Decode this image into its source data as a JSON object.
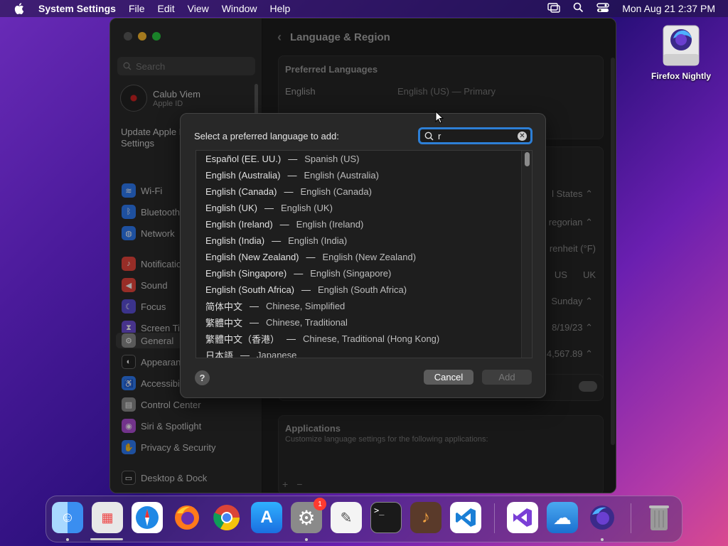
{
  "menubar": {
    "app_name": "System Settings",
    "items": [
      "File",
      "Edit",
      "View",
      "Window",
      "Help"
    ],
    "clock": "Mon Aug 21  2:37 PM"
  },
  "sidebar": {
    "search_placeholder": "Search",
    "profile": {
      "name": "Calub Viem",
      "sub": "Apple ID"
    },
    "update_text": "Update Apple ID Settings",
    "items": [
      {
        "label": "Wi-Fi",
        "color": "#2f7bf5",
        "icon": "wifi-icon"
      },
      {
        "label": "Bluetooth",
        "color": "#2f7bf5",
        "icon": "bluetooth-icon"
      },
      {
        "label": "Network",
        "color": "#2f7bf5",
        "icon": "globe-icon"
      },
      {
        "label": "Notifications",
        "color": "#e8453c",
        "icon": "bell-icon"
      },
      {
        "label": "Sound",
        "color": "#e8453c",
        "icon": "speaker-icon"
      },
      {
        "label": "Focus",
        "color": "#5b4fd6",
        "icon": "moon-icon"
      },
      {
        "label": "Screen Time",
        "color": "#6d4fd6",
        "icon": "hourglass-icon"
      },
      {
        "label": "General",
        "color": "#8a8a8a",
        "icon": "gear-icon"
      },
      {
        "label": "Appearance",
        "color": "#222222",
        "icon": "appearance-icon"
      },
      {
        "label": "Accessibility",
        "color": "#2f7bf5",
        "icon": "accessibility-icon"
      },
      {
        "label": "Control Center",
        "color": "#8a8a8a",
        "icon": "control-center-icon"
      },
      {
        "label": "Siri & Spotlight",
        "color": "#b04fd6",
        "icon": "siri-icon"
      },
      {
        "label": "Privacy & Security",
        "color": "#2f7bf5",
        "icon": "hand-icon"
      },
      {
        "label": "Desktop & Dock",
        "color": "#222222",
        "icon": "dock-icon"
      }
    ]
  },
  "content": {
    "title": "Language & Region",
    "preferred_header": "Preferred Languages",
    "pref_lang": "English",
    "pref_lang_detail": "English (US) — Primary",
    "bg_values": [
      "l States",
      "regorian",
      "renheit (°F)",
      "US",
      "UK",
      "Sunday",
      "8/19/23",
      "4,567.89"
    ],
    "applications_title": "Applications",
    "applications_desc": "Customize language settings for the following applications:",
    "plus": "+",
    "minus": "−"
  },
  "sheet": {
    "prompt": "Select a preferred language to add:",
    "search_value": "r",
    "languages": [
      {
        "native": "Español (EE. UU.)",
        "english": "Spanish (US)"
      },
      {
        "native": "English (Australia)",
        "english": "English (Australia)"
      },
      {
        "native": "English (Canada)",
        "english": "English (Canada)"
      },
      {
        "native": "English (UK)",
        "english": "English (UK)"
      },
      {
        "native": "English (Ireland)",
        "english": "English (Ireland)"
      },
      {
        "native": "English (India)",
        "english": "English (India)"
      },
      {
        "native": "English (New Zealand)",
        "english": "English (New Zealand)"
      },
      {
        "native": "English (Singapore)",
        "english": "English (Singapore)"
      },
      {
        "native": "English (South Africa)",
        "english": "English (South Africa)"
      },
      {
        "native": "简体中文",
        "english": "Chinese, Simplified"
      },
      {
        "native": "繁體中文",
        "english": "Chinese, Traditional"
      },
      {
        "native": "繁體中文（香港）",
        "english": "Chinese, Traditional (Hong Kong)"
      },
      {
        "native": "日本語",
        "english": "Japanese"
      }
    ],
    "dash": "—",
    "help": "?",
    "cancel": "Cancel",
    "add": "Add"
  },
  "desktop": {
    "icon_label": "Firefox Nightly"
  },
  "dock": {
    "apps": [
      {
        "name": "finder-icon",
        "color": "#3a8ef0",
        "glyph": "☺"
      },
      {
        "name": "launchpad-icon",
        "color": "#e8e8e8",
        "glyph": "▦"
      },
      {
        "name": "safari-icon",
        "color": "#1e88e5",
        "glyph": "⊕"
      },
      {
        "name": "firefox-icon",
        "color": "#ff7a1a",
        "glyph": "●"
      },
      {
        "name": "chrome-icon",
        "color": "#ffffff",
        "glyph": "◉"
      },
      {
        "name": "app-store-icon",
        "color": "#1e8cf0",
        "glyph": "A"
      },
      {
        "name": "system-settings-icon",
        "color": "#8a8a8a",
        "glyph": "⚙",
        "badge": "1"
      },
      {
        "name": "textedit-icon",
        "color": "#f4f4f4",
        "glyph": "✎"
      },
      {
        "name": "terminal-icon",
        "color": "#1a1a1a",
        "glyph": ">_"
      },
      {
        "name": "garageband-icon",
        "color": "#5a3a2a",
        "glyph": "♪"
      },
      {
        "name": "vscode-icon",
        "color": "#ffffff",
        "glyph": "◇"
      },
      {
        "name": "visual-studio-icon",
        "color": "#ffffff",
        "glyph": "◈"
      },
      {
        "name": "weather-icon",
        "color": "#3a8ef0",
        "glyph": "☁"
      },
      {
        "name": "firefox-nightly-icon",
        "color": "#3b2a8a",
        "glyph": "●"
      },
      {
        "name": "trash-icon",
        "color": "#8a8a8a",
        "glyph": "🗑"
      }
    ]
  }
}
